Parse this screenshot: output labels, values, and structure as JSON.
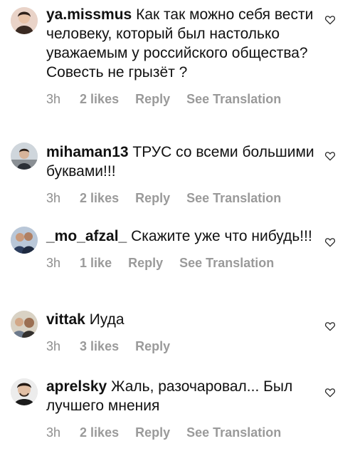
{
  "comments": [
    {
      "username": "ya.missmus",
      "text": "Как так можно себя вести человеку, который был настолько уважаемым у российского общества? Совесть не грызёт ?",
      "time": "3h",
      "likes": "2 likes",
      "reply": "Reply",
      "translate": "See Translation",
      "avatar_icon": "user-avatar-icon",
      "heart_icon": "heart-outline-icon"
    },
    {
      "username": "mihaman13",
      "text": "ТРУС со всеми большими буквами!!!",
      "time": "3h",
      "likes": "2 likes",
      "reply": "Reply",
      "translate": "See Translation",
      "avatar_icon": "user-avatar-icon",
      "heart_icon": "heart-outline-icon"
    },
    {
      "username": "_mo_afzal_",
      "text": "Скажите уже что нибудь!!!",
      "time": "3h",
      "likes": "1 like",
      "reply": "Reply",
      "translate": "See Translation",
      "avatar_icon": "user-avatar-icon",
      "heart_icon": "heart-outline-icon"
    },
    {
      "username": "vittak",
      "text": "Иуда",
      "time": "3h",
      "likes": "3 likes",
      "reply": "Reply",
      "avatar_icon": "user-avatar-icon",
      "heart_icon": "heart-outline-icon"
    },
    {
      "username": "aprelsky",
      "text": "Жаль, разочаровал... Был лучшего мнения",
      "time": "3h",
      "likes": "2 likes",
      "reply": "Reply",
      "translate": "See Translation",
      "avatar_icon": "user-avatar-icon",
      "heart_icon": "heart-outline-icon"
    }
  ],
  "colors": {
    "text": "#111111",
    "meta": "#8e8e8e",
    "heart_stroke": "#262626"
  }
}
